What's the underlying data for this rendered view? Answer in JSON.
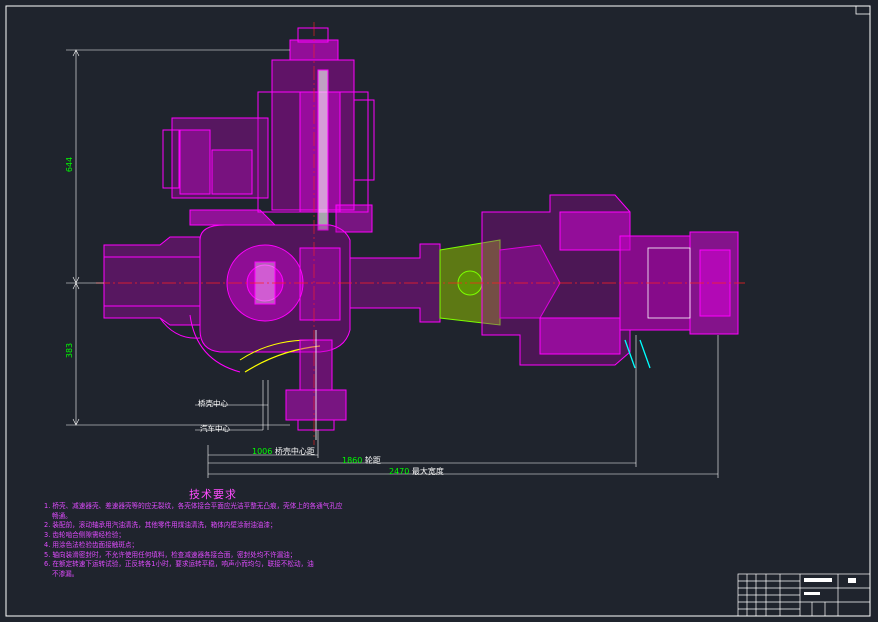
{
  "drawing": {
    "dimensions": {
      "height_upper": "644",
      "height_lower": "383",
      "axle_center": "1006",
      "axle_center_label": "桥壳中心距",
      "track": "1860",
      "track_label": "轮距",
      "max_width": "2470",
      "max_width_label": "最大宽度"
    },
    "labels": {
      "axle_center_line": "桥壳中心",
      "vehicle_center_line": "汽车中心"
    },
    "colors": {
      "background": "#1f242d",
      "part": "#ff00ff",
      "dimension": "#00ff00",
      "line": "#ffffff",
      "accent_yellow": "#ffff00",
      "accent_green": "#7cff00",
      "accent_cyan": "#00ffff",
      "center_line": "#ff2020"
    }
  },
  "tech_requirements": {
    "title": "技术要求",
    "items": [
      "1. 桥壳、减速器壳、差速器壳等的应无裂纹，各壳体接合平面应光洁平整无凸痕，壳体上的各通气孔应",
      "畅通。",
      "2. 装配前，滚动轴承用汽油清洗，其他零件用煤油清洗，箱体内壁涂耐油油漆；",
      "3. 齿轮啮合侧隙需经检验；",
      "4. 用涂色法检验齿面接触斑点；",
      "5. 轴向装滑密封时，不允许使用任何填料，检查减速器各接合面，密封处均不许漏油；",
      "6. 在额定转速下运转试验，正反转各1小时，要求运转平稳，响声小而均匀，联接不松动，油",
      "不渗漏。"
    ]
  }
}
